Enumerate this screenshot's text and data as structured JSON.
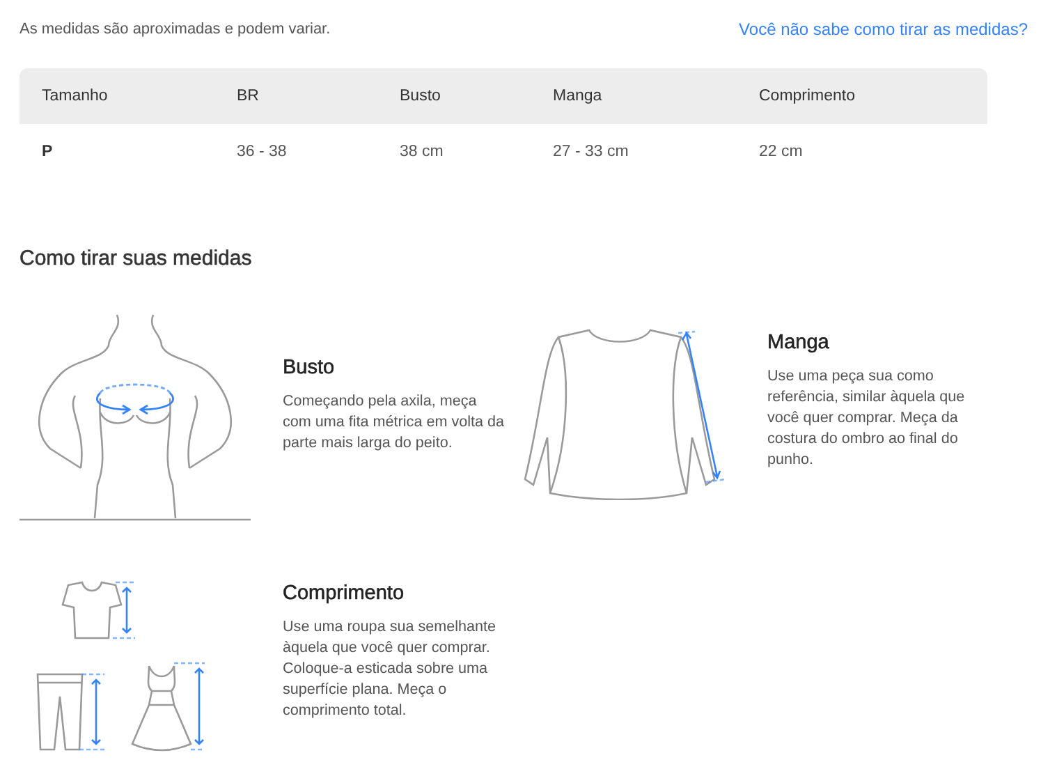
{
  "note": "As medidas são aproximadas e podem variar.",
  "help_link": "Você não sabe como tirar as medidas?",
  "table": {
    "columns": [
      "Tamanho",
      "BR",
      "Busto",
      "Manga",
      "Comprimento"
    ],
    "rows": [
      [
        "P",
        "36 - 38",
        "38 cm",
        "27 - 33 cm",
        "22 cm"
      ]
    ]
  },
  "guide": {
    "title": "Como tirar suas medidas",
    "items": [
      {
        "kind": "bust",
        "title": "Busto",
        "text": "Começando pela axila, meça com uma fita métrica em volta da parte mais larga do peito."
      },
      {
        "kind": "sleeve",
        "title": "Manga",
        "text": "Use uma peça sua como referência, similar àquela que você quer comprar. Meça da costura do ombro ao final do punho."
      },
      {
        "kind": "length",
        "title": "Comprimento",
        "text": "Use uma roupa sua semelhante àquela que você quer comprar. Coloque-a esticada sobre uma superfície plana. Meça o comprimento total."
      }
    ]
  }
}
